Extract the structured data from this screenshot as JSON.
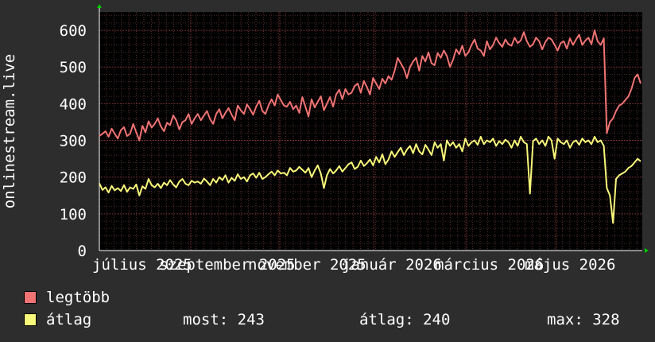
{
  "chart_data": {
    "type": "line",
    "ylabel": "onlinestream.live",
    "ylim": [
      0,
      650
    ],
    "yticks": [
      0,
      100,
      200,
      300,
      400,
      500,
      600
    ],
    "xlabels": [
      "július 2025",
      "szeptember 2025",
      "november 2025",
      "január 2026",
      "március 2026",
      "május 2026"
    ],
    "grid": true,
    "legend_position": "bottom-left",
    "series": [
      {
        "name": "legtöbb",
        "color": "#f07373",
        "values": [
          312,
          318,
          325,
          310,
          332,
          318,
          305,
          328,
          336,
          312,
          318,
          345,
          322,
          300,
          340,
          322,
          352,
          335,
          345,
          360,
          338,
          325,
          348,
          342,
          368,
          355,
          330,
          350,
          355,
          372,
          345,
          360,
          372,
          355,
          368,
          380,
          358,
          345,
          372,
          385,
          360,
          375,
          388,
          370,
          355,
          395,
          382,
          372,
          398,
          385,
          370,
          392,
          408,
          380,
          372,
          395,
          412,
          395,
          425,
          410,
          395,
          392,
          405,
          385,
          395,
          375,
          418,
          392,
          365,
          412,
          390,
          405,
          420,
          382,
          400,
          418,
          392,
          425,
          438,
          412,
          440,
          425,
          430,
          448,
          455,
          430,
          462,
          445,
          425,
          470,
          455,
          440,
          468,
          455,
          475,
          465,
          490,
          525,
          510,
          495,
          470,
          500,
          515,
          525,
          490,
          530,
          515,
          540,
          510,
          505,
          538,
          525,
          545,
          530,
          500,
          520,
          548,
          535,
          558,
          530,
          540,
          560,
          575,
          550,
          545,
          530,
          570,
          548,
          560,
          580,
          565,
          555,
          575,
          562,
          558,
          580,
          565,
          572,
          595,
          570,
          555,
          562,
          580,
          570,
          548,
          568,
          580,
          575,
          560,
          545,
          565,
          570,
          550,
          578,
          560,
          575,
          588,
          560,
          572,
          580,
          562,
          600,
          570,
          560,
          578,
          320,
          350,
          360,
          380,
          395,
          400,
          410,
          420,
          440,
          470,
          480,
          455
        ]
      },
      {
        "name": "átlag",
        "color": "#f8f87a",
        "values": [
          183,
          165,
          172,
          158,
          176,
          164,
          170,
          162,
          178,
          160,
          172,
          168,
          180,
          150,
          175,
          168,
          195,
          178,
          172,
          182,
          170,
          185,
          178,
          192,
          180,
          172,
          188,
          195,
          182,
          178,
          190,
          185,
          188,
          182,
          196,
          188,
          178,
          195,
          185,
          200,
          192,
          205,
          185,
          198,
          190,
          208,
          195,
          200,
          188,
          205,
          210,
          198,
          212,
          195,
          200,
          208,
          215,
          205,
          218,
          210,
          212,
          205,
          225,
          215,
          218,
          228,
          220,
          212,
          225,
          200,
          218,
          232,
          210,
          170,
          205,
          222,
          210,
          218,
          230,
          215,
          225,
          235,
          240,
          222,
          228,
          245,
          230,
          238,
          248,
          232,
          255,
          240,
          262,
          235,
          248,
          270,
          255,
          268,
          280,
          260,
          275,
          285,
          265,
          290,
          270,
          262,
          288,
          275,
          260,
          295,
          280,
          290,
          245,
          300,
          285,
          295,
          280,
          290,
          270,
          305,
          285,
          295,
          300,
          288,
          310,
          290,
          300,
          295,
          305,
          285,
          298,
          290,
          302,
          295,
          280,
          300,
          285,
          310,
          295,
          290,
          155,
          298,
          305,
          290,
          300,
          285,
          310,
          300,
          250,
          305,
          295,
          290,
          300,
          280,
          295,
          300,
          288,
          305,
          295,
          300,
          290,
          310,
          295,
          300,
          285,
          170,
          150,
          75,
          195,
          205,
          210,
          215,
          225,
          230,
          240,
          250,
          243
        ]
      }
    ],
    "stats": {
      "current_label": "most:",
      "current": 243,
      "average_label": "átlag:",
      "average": 240,
      "max_label": "max:",
      "max": 328
    }
  }
}
